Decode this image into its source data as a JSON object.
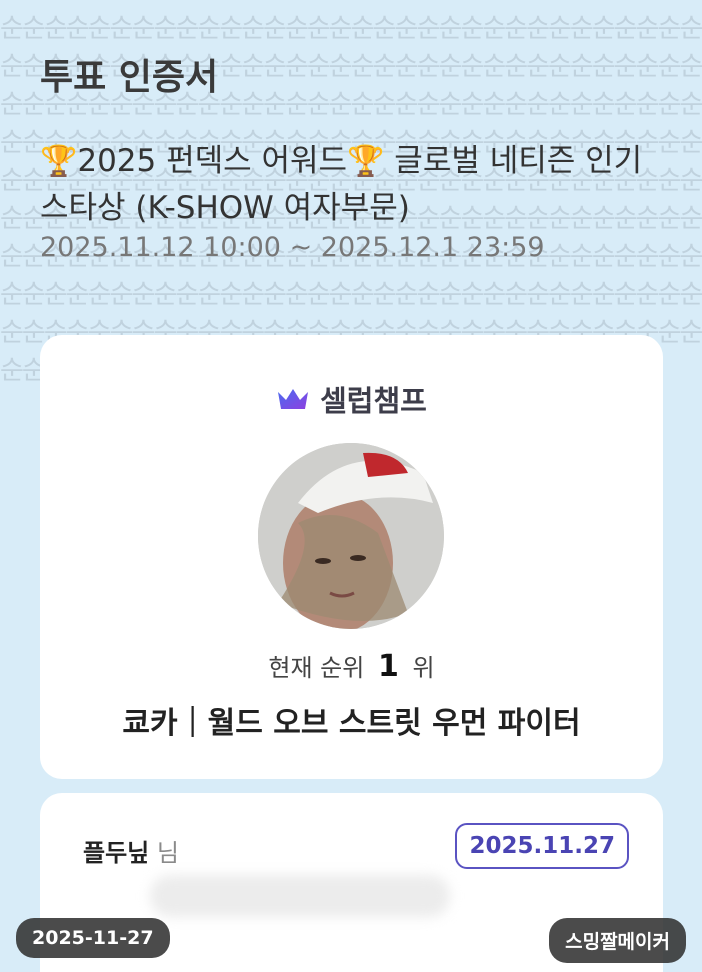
{
  "certificate": {
    "title": "투표 인증서",
    "event_icon": "trophy-icon",
    "event_part1": "2025 펀덱스 어워드",
    "event_part2": " 글로벌 네티즌 인기 스타상 (K-SHOW 여자부문)",
    "period": "2025.11.12 10:00 ~ 2025.12.1 23:59"
  },
  "card": {
    "brand_icon": "crown-icon",
    "brand_name": "셀럽챔프",
    "rank_prefix": "현재 순위",
    "rank_value": "1",
    "rank_suffix": "위",
    "artist": "쿄카｜월드 오브 스트릿 우먼 파이터"
  },
  "vote": {
    "voter_name": "플두닢",
    "voter_suffix": "님",
    "date": "2025.11.27"
  },
  "footer": {
    "date_stamp": "2025-11-27",
    "maker": "스밍짤메이커"
  },
  "colors": {
    "background": "#d8ecf8",
    "brand_purple": "#6b4fe0",
    "badge_border": "#5a53c2"
  }
}
